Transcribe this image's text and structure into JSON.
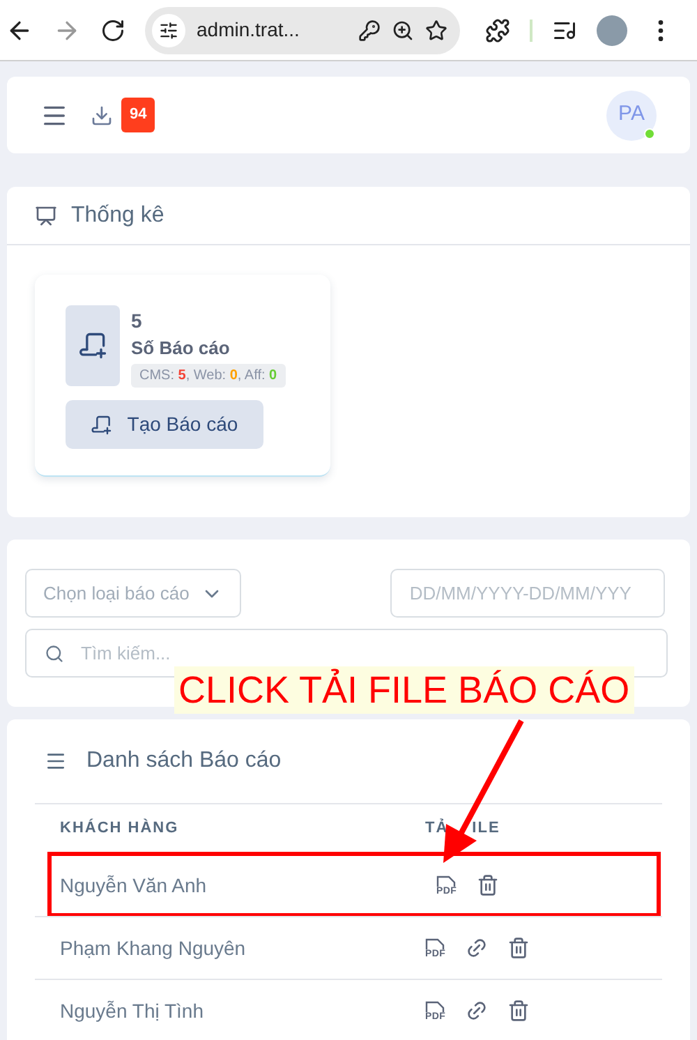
{
  "browser": {
    "url": "admin.trat..."
  },
  "header": {
    "badge": "94",
    "avatar": "PA",
    "online": true
  },
  "stats": {
    "title": "Thống kê",
    "card": {
      "count": "5",
      "label": "Số Báo cáo",
      "breakdown": [
        {
          "label": "CMS: ",
          "value": "5",
          "color": "#f44336",
          "sep": ", "
        },
        {
          "label": "Web: ",
          "value": "0",
          "color": "#ffa000",
          "sep": ", "
        },
        {
          "label": "Aff: ",
          "value": "0",
          "color": "#66cc33"
        }
      ],
      "button": "Tạo Báo cáo"
    }
  },
  "filters": {
    "type_placeholder": "Chọn loại báo cáo",
    "date_placeholder": "DD/MM/YYYY-DD/MM/YYY",
    "search_placeholder": "Tìm kiếm..."
  },
  "callout": {
    "text": "CLICK TẢI FILE BÁO CÁO"
  },
  "list": {
    "title": "Danh sách Báo cáo",
    "columns": [
      {
        "parts": [
          "KHÁCH HÀNG"
        ]
      },
      {
        "parts": [
          "TẢ",
          "ILE"
        ]
      }
    ],
    "rows": [
      {
        "name": "Nguyễn Văn Anh",
        "highlighted": true,
        "actions": [
          {
            "kind": "pdf",
            "label": "PDF"
          },
          {
            "kind": "delete"
          }
        ]
      },
      {
        "name": "Phạm Khang Nguyên",
        "highlighted": false,
        "actions": [
          {
            "kind": "pdf",
            "label": "PDF"
          },
          {
            "kind": "link"
          },
          {
            "kind": "delete"
          }
        ]
      },
      {
        "name": "Nguyễn Thị Tình",
        "highlighted": false,
        "actions": [
          {
            "kind": "pdf",
            "label": "PDF"
          },
          {
            "kind": "link"
          },
          {
            "kind": "delete"
          }
        ]
      }
    ]
  }
}
